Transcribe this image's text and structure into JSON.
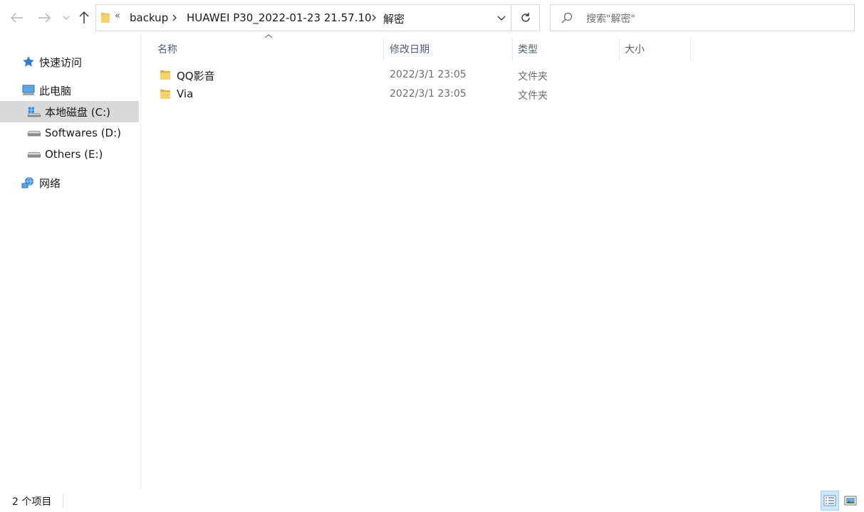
{
  "toolbar": {
    "back_icon": "arrow-left-icon",
    "forward_icon": "arrow-right-icon",
    "recent_icon": "chevron-down-icon",
    "up_icon": "arrow-up-icon"
  },
  "address": {
    "overflow": "«",
    "breadcrumbs": [
      "backup",
      "HUAWEI P30_2022-01-23 21.57.10",
      "解密"
    ]
  },
  "search": {
    "placeholder": "搜索\"解密\""
  },
  "sidebar": {
    "items": [
      {
        "label": "快速访问",
        "icon": "star-icon"
      },
      {
        "label": "此电脑",
        "icon": "computer-icon"
      },
      {
        "label": "本地磁盘 (C:)",
        "icon": "windows-drive-icon",
        "selected": true
      },
      {
        "label": "Softwares (D:)",
        "icon": "drive-icon"
      },
      {
        "label": "Others (E:)",
        "icon": "drive-icon"
      },
      {
        "label": "网络",
        "icon": "network-icon"
      }
    ]
  },
  "columns": [
    "名称",
    "修改日期",
    "类型",
    "大小"
  ],
  "files": [
    {
      "name": "QQ影音",
      "date": "2022/3/1 23:05",
      "type": "文件夹"
    },
    {
      "name": "Via",
      "date": "2022/3/1 23:05",
      "type": "文件夹"
    }
  ],
  "status": {
    "item_count": "2 个项目"
  },
  "colors": {
    "selected_bg": "#d9d9d9",
    "folder_yellow": "#f3c444",
    "header_text": "#4c607a",
    "view_active_bg": "#cce8ff"
  }
}
